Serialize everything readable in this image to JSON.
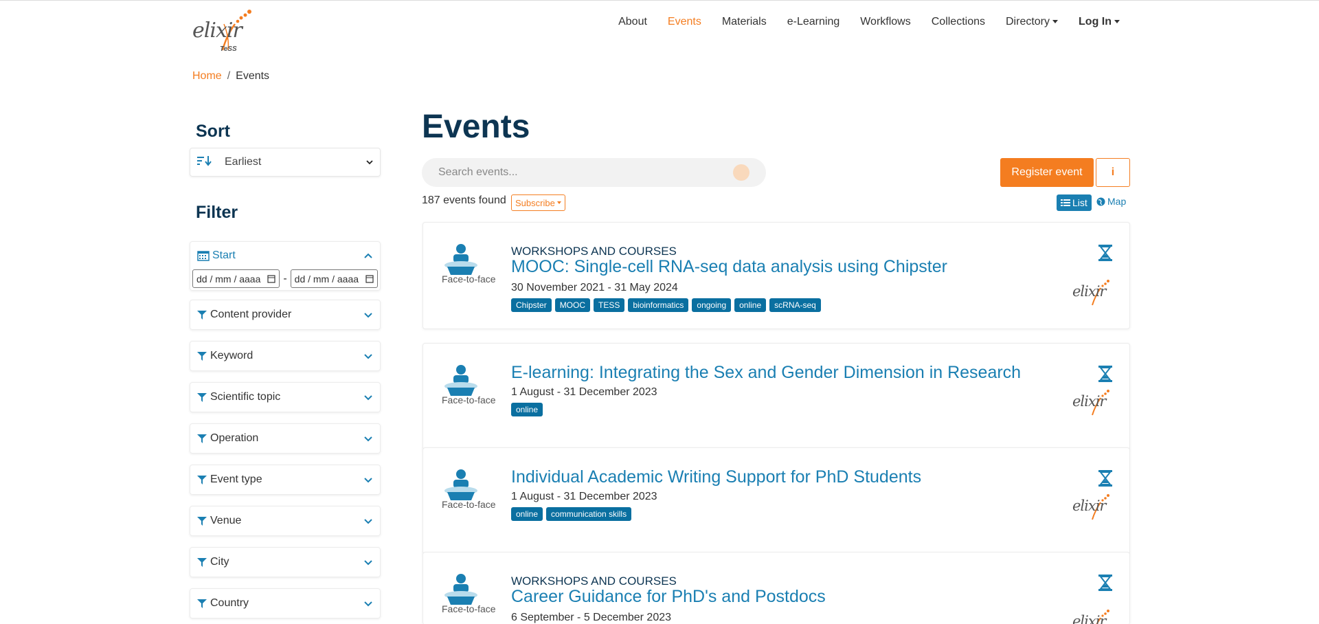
{
  "header": {
    "logo_text": "elixir",
    "logo_sub": "TeSS",
    "nav": {
      "about": "About",
      "events": "Events",
      "materials": "Materials",
      "elearning": "e-Learning",
      "workflows": "Workflows",
      "collections": "Collections",
      "directory": "Directory",
      "login": "Log In"
    }
  },
  "breadcrumb": {
    "home": "Home",
    "sep": "/",
    "current": "Events"
  },
  "sidebar": {
    "sort_heading": "Sort",
    "sort_value": "Earliest",
    "filter_heading": "Filter",
    "start": {
      "label": "Start",
      "from_placeholder": "dd / mm / aaaa",
      "to_placeholder": "dd / mm / aaaa",
      "dash": "-"
    },
    "filters": {
      "content_provider": "Content provider",
      "keyword": "Keyword",
      "scientific_topic": "Scientific topic",
      "operation": "Operation",
      "event_type": "Event type",
      "venue": "Venue",
      "city": "City",
      "country": "Country"
    }
  },
  "main": {
    "title": "Events",
    "search_placeholder": "Search events...",
    "register_label": "Register event",
    "info_label": "i",
    "found": "187 events found",
    "subscribe_label": "Subscribe",
    "list_label": "List",
    "map_label": "Map",
    "events": [
      {
        "type": "WORKSHOPS AND COURSES",
        "title": "MOOC: Single-cell RNA-seq data analysis using Chipster",
        "date": "30 November 2021 - 31 May 2024",
        "mode": "Face-to-face",
        "tags": [
          "Chipster",
          "MOOC",
          "TESS",
          "bioinformatics",
          "ongoing",
          "online",
          "scRNA-seq"
        ]
      },
      {
        "type": "",
        "title": "E-learning: Integrating the Sex and Gender Dimension in Research",
        "date": "1 August - 31 December 2023",
        "mode": "Face-to-face",
        "tags": [
          "online"
        ]
      },
      {
        "type": "",
        "title": "Individual Academic Writing Support for PhD Students",
        "date": "1 August - 31 December 2023",
        "mode": "Face-to-face",
        "tags": [
          "online",
          "communication skills"
        ]
      },
      {
        "type": "WORKSHOPS AND COURSES",
        "title": "Career Guidance for PhD's and Postdocs",
        "date": "6 September - 5 December 2023",
        "mode": "Face-to-face",
        "tags": []
      }
    ]
  },
  "colors": {
    "accent": "#f47d20",
    "primary": "#1a7fb2",
    "heading": "#0d3552",
    "tag": "#0a6fa0"
  },
  "icons": {
    "sort": "sort-amount-icon",
    "calendar": "calendar-icon",
    "filter": "funnel-icon",
    "chevron": "chevron-icon",
    "search": "search-icon",
    "info": "info-icon",
    "list": "list-icon",
    "map": "globe-icon",
    "person": "person-icon",
    "hourglass": "hourglass-icon"
  }
}
